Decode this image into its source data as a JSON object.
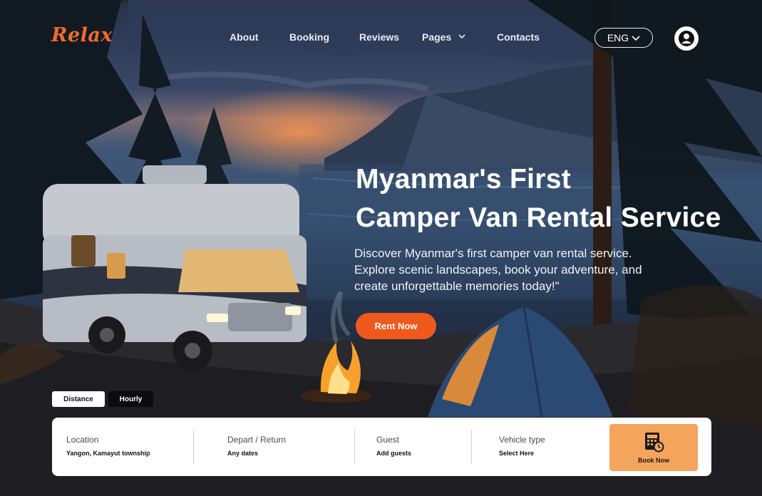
{
  "brand": {
    "logo_text": "Relax",
    "accent_color": "#ef5a1c"
  },
  "nav": {
    "items": [
      {
        "label": "About"
      },
      {
        "label": "Booking"
      },
      {
        "label": "Reviews"
      },
      {
        "label": "Pages",
        "icon": "chevron-down-icon"
      },
      {
        "label": "Contacts"
      }
    ],
    "language": {
      "label": "ENG",
      "icon": "chevron-down-icon"
    },
    "profile_icon": "user-avatar-icon"
  },
  "hero": {
    "headline_line1": "Myanmar's First",
    "headline_line2": "Camper Van Rental Service",
    "subtext_line1": "Discover Myanmar's first camper van rental service.",
    "subtext_line2": "Explore scenic landscapes, book your adventure, and",
    "subtext_line3": "create unforgettable memories today!\"",
    "cta_label": "Rent Now"
  },
  "booking": {
    "modes": [
      {
        "label": "Distance",
        "active": true
      },
      {
        "label": "Hourly",
        "active": false
      }
    ],
    "fields": [
      {
        "label": "Location",
        "value": "Yangon, Kamayut township"
      },
      {
        "label": "Depart / Return",
        "value": "Any dates"
      },
      {
        "label": "Guest",
        "value": "Add guests"
      },
      {
        "label": "Vehicle type",
        "value": "Select Here"
      }
    ],
    "book_button": {
      "label": "Book Now",
      "icon": "calculator-clock-icon",
      "color": "#f5a45c"
    }
  }
}
